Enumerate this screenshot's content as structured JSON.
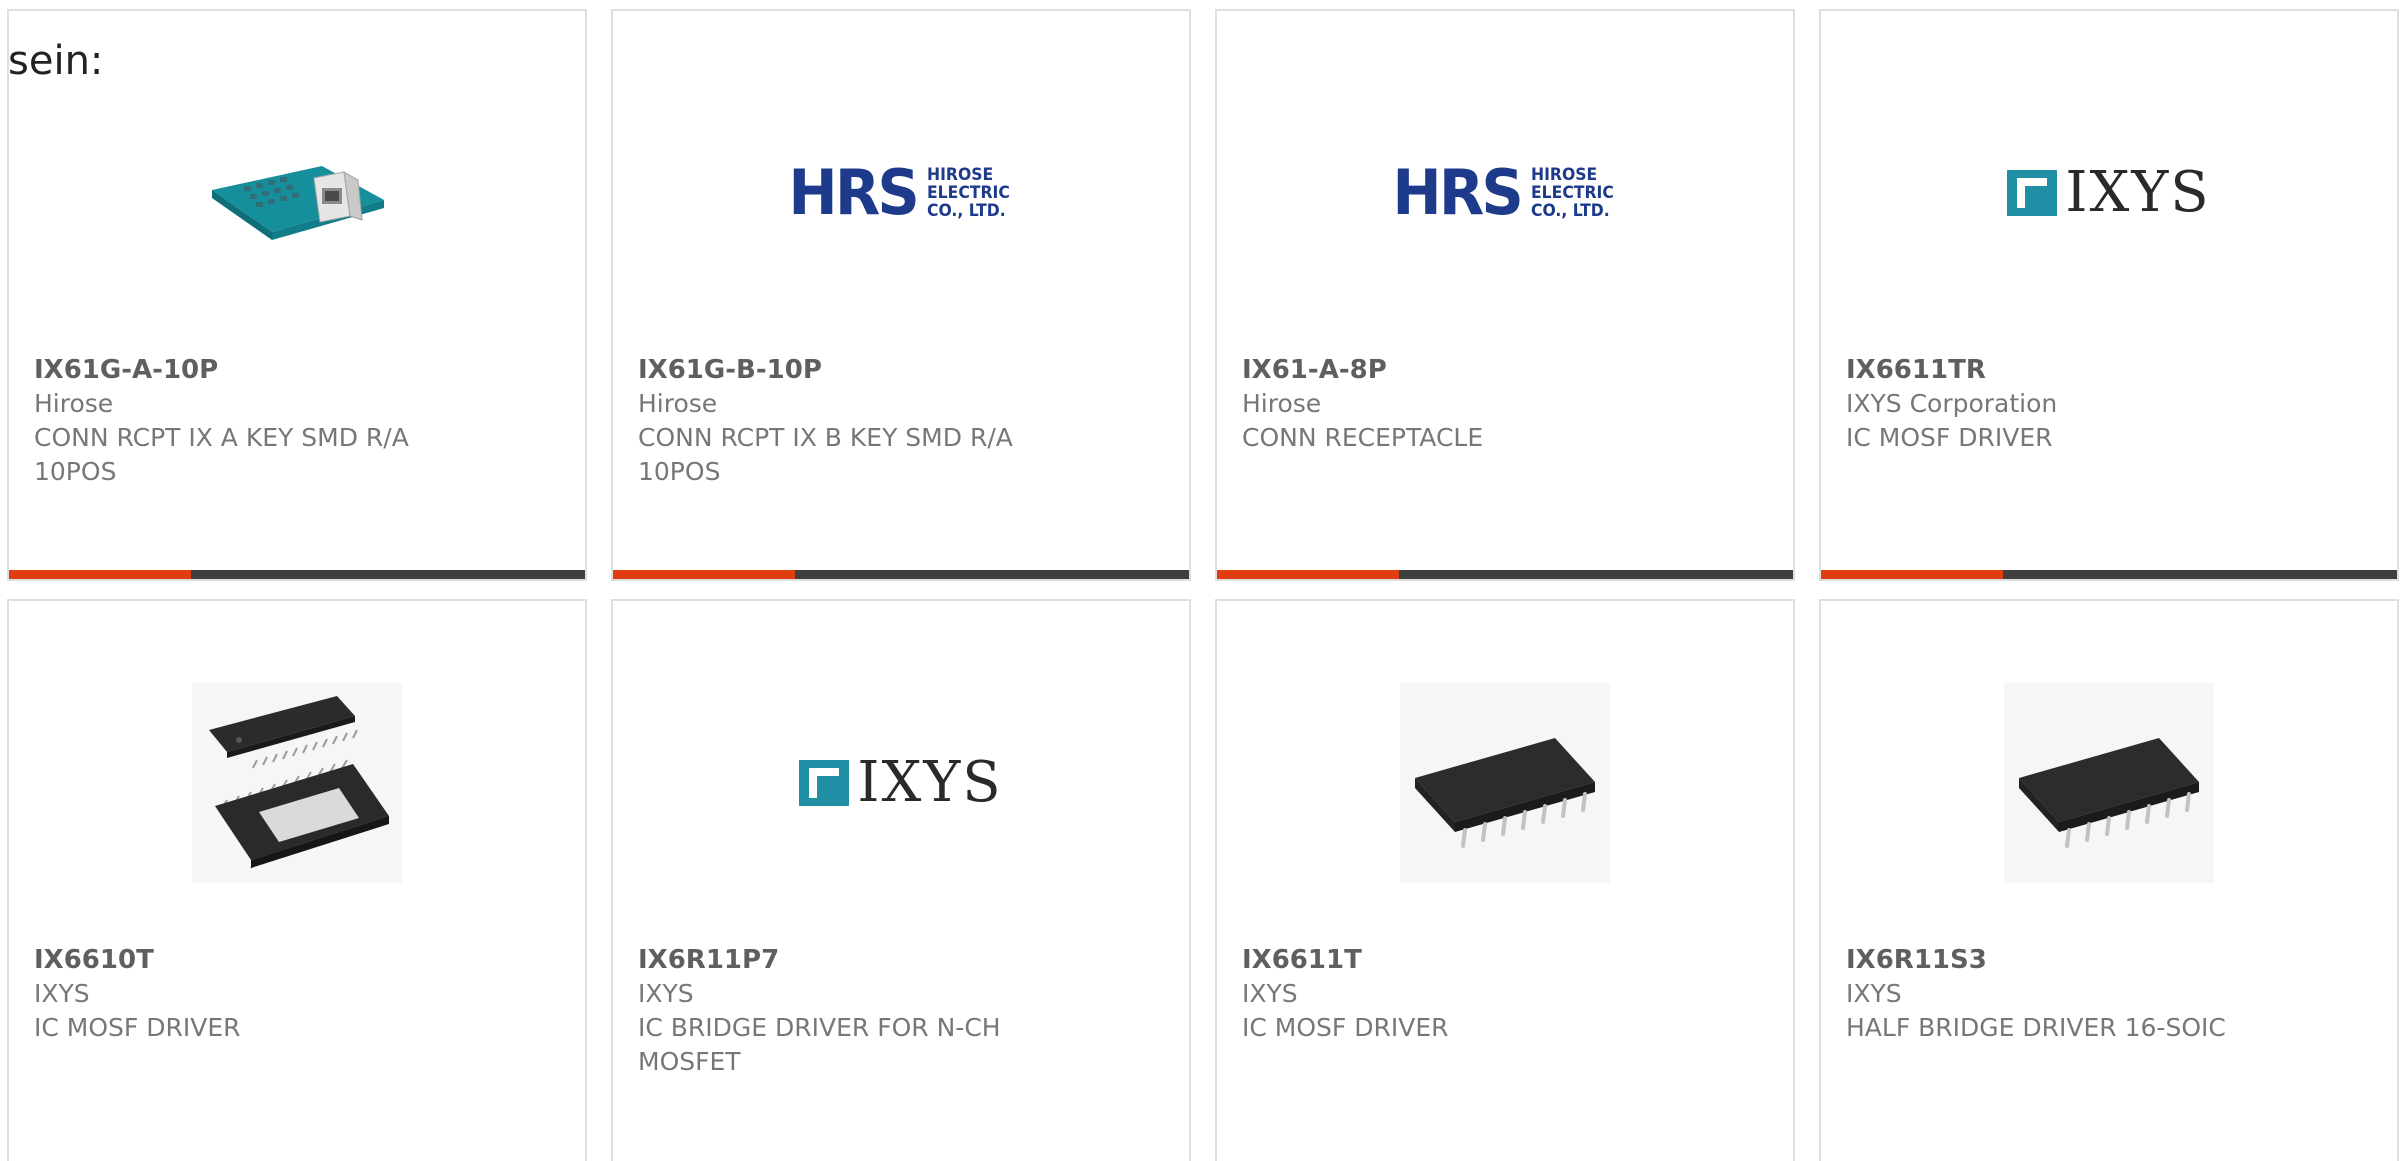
{
  "intro_text": "sein:",
  "accent_color": "#e03d13",
  "bar_color": "#3f3f3f",
  "logos": {
    "hrs": {
      "letters": "HRS",
      "line1": "HIROSE",
      "line2": "ELECTRIC",
      "line3": "CO., LTD."
    },
    "ixys": {
      "text": "IXYS"
    }
  },
  "products": [
    {
      "part": "IX61G-A-10P",
      "maker": "Hirose",
      "desc": "CONN RCPT IX A KEY SMD R/A 10POS",
      "image": "connector-photo"
    },
    {
      "part": "IX61G-B-10P",
      "maker": "Hirose",
      "desc": "CONN RCPT IX B KEY SMD R/A 10POS",
      "image": "hrs-logo"
    },
    {
      "part": "IX61-A-8P",
      "maker": "Hirose",
      "desc": "CONN RECEPTACLE",
      "image": "hrs-logo"
    },
    {
      "part": "IX6611TR",
      "maker": "IXYS Corporation",
      "desc": "IC MOSF DRIVER",
      "image": "ixys-logo"
    },
    {
      "part": "IX6610T",
      "maker": "IXYS",
      "desc": "IC MOSF DRIVER",
      "image": "tssop-chip-photo"
    },
    {
      "part": "IX6R11P7",
      "maker": "IXYS",
      "desc": "IC BRIDGE DRIVER FOR N-CH MOSFET",
      "image": "ixys-logo"
    },
    {
      "part": "IX6611T",
      "maker": "IXYS",
      "desc": "IC MOSF DRIVER",
      "image": "soic-chip-photo"
    },
    {
      "part": "IX6R11S3",
      "maker": "IXYS",
      "desc": "HALF BRIDGE DRIVER 16-SOIC",
      "image": "soic-chip-photo"
    }
  ]
}
